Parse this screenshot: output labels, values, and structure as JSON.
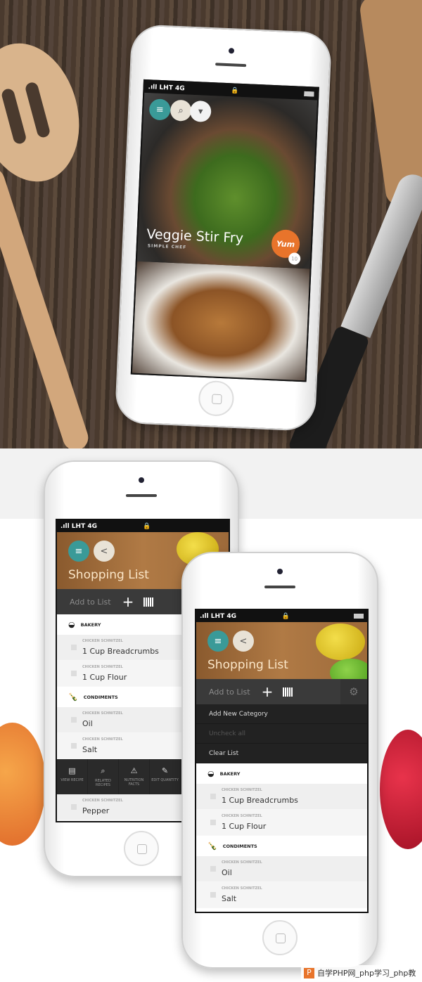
{
  "status": {
    "carrier": ".ıll LHT 4G",
    "lock": "🔒"
  },
  "recipe": {
    "title": "Veggie Stir Fry",
    "subtitle": "SIMPLE CHEF",
    "badge": "Yum",
    "count": "10",
    "icons": [
      "menu-icon",
      "search-icon",
      "filter-icon"
    ]
  },
  "shopping": {
    "title": "Shopping List",
    "add_label": "Add to List",
    "plus": "+",
    "gear": "⚙",
    "menu": [
      "Add New Category",
      "Uncheck all",
      "Clear List"
    ],
    "categories": [
      {
        "name": "BAKERY",
        "icon": "bread-icon",
        "items": [
          {
            "recipe": "CHICKEN SCHNITZEL",
            "name": "1 Cup Breadcrumbs"
          },
          {
            "recipe": "CHICKEN SCHNITZEL",
            "name": "1 Cup Flour"
          }
        ]
      },
      {
        "name": "CONDIMENTS",
        "icon": "bottle-icon",
        "items": [
          {
            "recipe": "CHICKEN SCHNITZEL",
            "name": "Oil"
          },
          {
            "recipe": "CHICKEN SCHNITZEL",
            "name": "Salt"
          },
          {
            "recipe": "CHICKEN SCHNITZEL",
            "name": "Pepper"
          }
        ]
      }
    ],
    "actions": [
      "VIEW RECIPE",
      "RELATED RECIPES",
      "NUTRITION FACTS",
      "EDIT QUANTITY"
    ]
  },
  "watermark": {
    "logo": "P",
    "text": "自学PHP网_php学习_php教"
  },
  "colors": {
    "teal": "#3a9a98",
    "orange": "#e8742b",
    "dark": "#2a2a2a"
  }
}
